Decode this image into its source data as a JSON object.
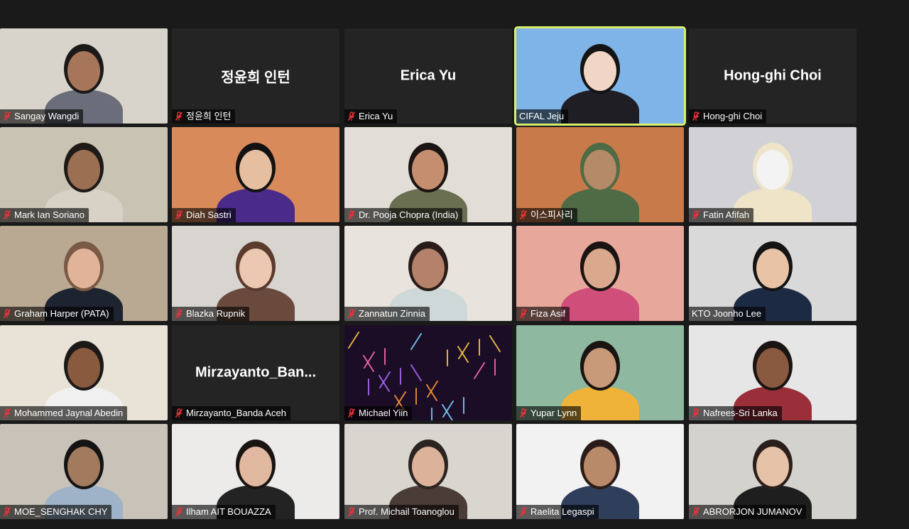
{
  "participants": [
    {
      "name": "Sangay Wangdi",
      "display": "video",
      "bg": "#d8d4cc",
      "skin": "#a7755a",
      "shirt": "#6b6e7a",
      "hair": "#1c1a18"
    },
    {
      "name": "정윤희 인턴",
      "display": "정윤희 인턴"
    },
    {
      "name": "Erica Yu",
      "display": "Erica Yu"
    },
    {
      "name": "CIFAL Jeju",
      "display": "video",
      "bg": "#7fb4e8",
      "skin": "#f1d6c6",
      "shirt": "#1e1e24",
      "hair": "#141414",
      "active": true
    },
    {
      "name": "Hong-ghi Choi",
      "display": "Hong-ghi Choi"
    },
    {
      "name": "Mark Ian Soriano",
      "display": "video",
      "bg": "#c9c3b4",
      "skin": "#9b6f52",
      "shirt": "#d7d1c6",
      "hair": "#1d1a17"
    },
    {
      "name": "Diah Sastri",
      "display": "video",
      "bg": "#d88a5a",
      "skin": "#e6bfa0",
      "shirt": "#4a2b8a",
      "hair": "#121212"
    },
    {
      "name": "Dr. Pooja Chopra (India)",
      "display": "video",
      "bg": "#e2ddd6",
      "skin": "#c58e6e",
      "shirt": "#6a6f52",
      "hair": "#1a1412"
    },
    {
      "name": "이스피사리",
      "display": "video",
      "bg": "#c97a4a",
      "skin": "#b48a68",
      "shirt": "#4f6b45",
      "hair": "#4f6b45"
    },
    {
      "name": "Fatin Afifah",
      "display": "video",
      "bg": "#d2d2d6",
      "skin": "#f3f3f3",
      "shirt": "#efe4c8",
      "hair": "#efe4c8"
    },
    {
      "name": "Graham Harper (PATA)",
      "display": "video",
      "bg": "#b9a992",
      "skin": "#e1b49a",
      "shirt": "#1d2430",
      "hair": "#7a5a45"
    },
    {
      "name": "Blazka Rupnik",
      "display": "video",
      "bg": "#d8d4cf",
      "skin": "#ecc8b3",
      "shirt": "#6b4a3e",
      "hair": "#5a3b2c"
    },
    {
      "name": "Zannatun Zinnia",
      "display": "video",
      "bg": "#e8e3dc",
      "skin": "#b4826a",
      "shirt": "#cfd8d8",
      "hair": "#2a1c18"
    },
    {
      "name": "Fiza Asif",
      "display": "video",
      "bg": "#e7a79a",
      "skin": "#d9a88d",
      "shirt": "#d04e7a",
      "hair": "#1a1412"
    },
    {
      "name": "KTO Joonho Lee",
      "display": "video",
      "bg": "#d9d9d9",
      "skin": "#e8c3a6",
      "shirt": "#1d2a44",
      "hair": "#141414"
    },
    {
      "name": "Mohammed Jaynal Abedin",
      "display": "video",
      "bg": "#e9e2d6",
      "skin": "#8a5a3e",
      "shirt": "#f0f0f0",
      "hair": "#1c1a18"
    },
    {
      "name": "Mirzayanto_Banda Aceh",
      "display": "Mirzayanto_Ban..."
    },
    {
      "name": "Michael Yiin",
      "display": "video",
      "bg": "#1b0d26",
      "skin": "#1b0d26",
      "shirt": "#1b0d26",
      "hair": "#1b0d26"
    },
    {
      "name": "Yupar Lynn",
      "display": "video",
      "bg": "#8fb8a0",
      "skin": "#c99a7a",
      "shirt": "#f0b33a",
      "hair": "#1a1412"
    },
    {
      "name": "Nafrees-Sri Lanka",
      "display": "video",
      "bg": "#e6e6e6",
      "skin": "#8a5a40",
      "shirt": "#9a2f3a",
      "hair": "#1a1412"
    },
    {
      "name": "MOE_SENGHAK CHY",
      "display": "video",
      "bg": "#c8c2b8",
      "skin": "#a27a5e",
      "shirt": "#9fb3c8",
      "hair": "#141414"
    },
    {
      "name": "Ilham AIT BOUAZZA",
      "display": "video",
      "bg": "#ecebea",
      "skin": "#e0b9a0",
      "shirt": "#232323",
      "hair": "#1a1412"
    },
    {
      "name": "Prof. Michail Toanoglou",
      "display": "video",
      "bg": "#d9d6d0",
      "skin": "#dcb29a",
      "shirt": "#4a3c36",
      "hair": "#2b2420"
    },
    {
      "name": "Raelita Legaspi",
      "display": "video",
      "bg": "#f2f2f2",
      "skin": "#b98a6a",
      "shirt": "#2f3e5a",
      "hair": "#2a1c18"
    },
    {
      "name": "ABRORJON JUMANOV",
      "display": "video",
      "bg": "#d4d2cd",
      "skin": "#e6c2a8",
      "shirt": "#1e1e1e",
      "hair": "#2a1f1a"
    }
  ],
  "colors": {
    "background": "#1a1a1a",
    "tile": "#242424",
    "active_border": "#d8ef6b",
    "mute_icon": "#e8343b"
  }
}
